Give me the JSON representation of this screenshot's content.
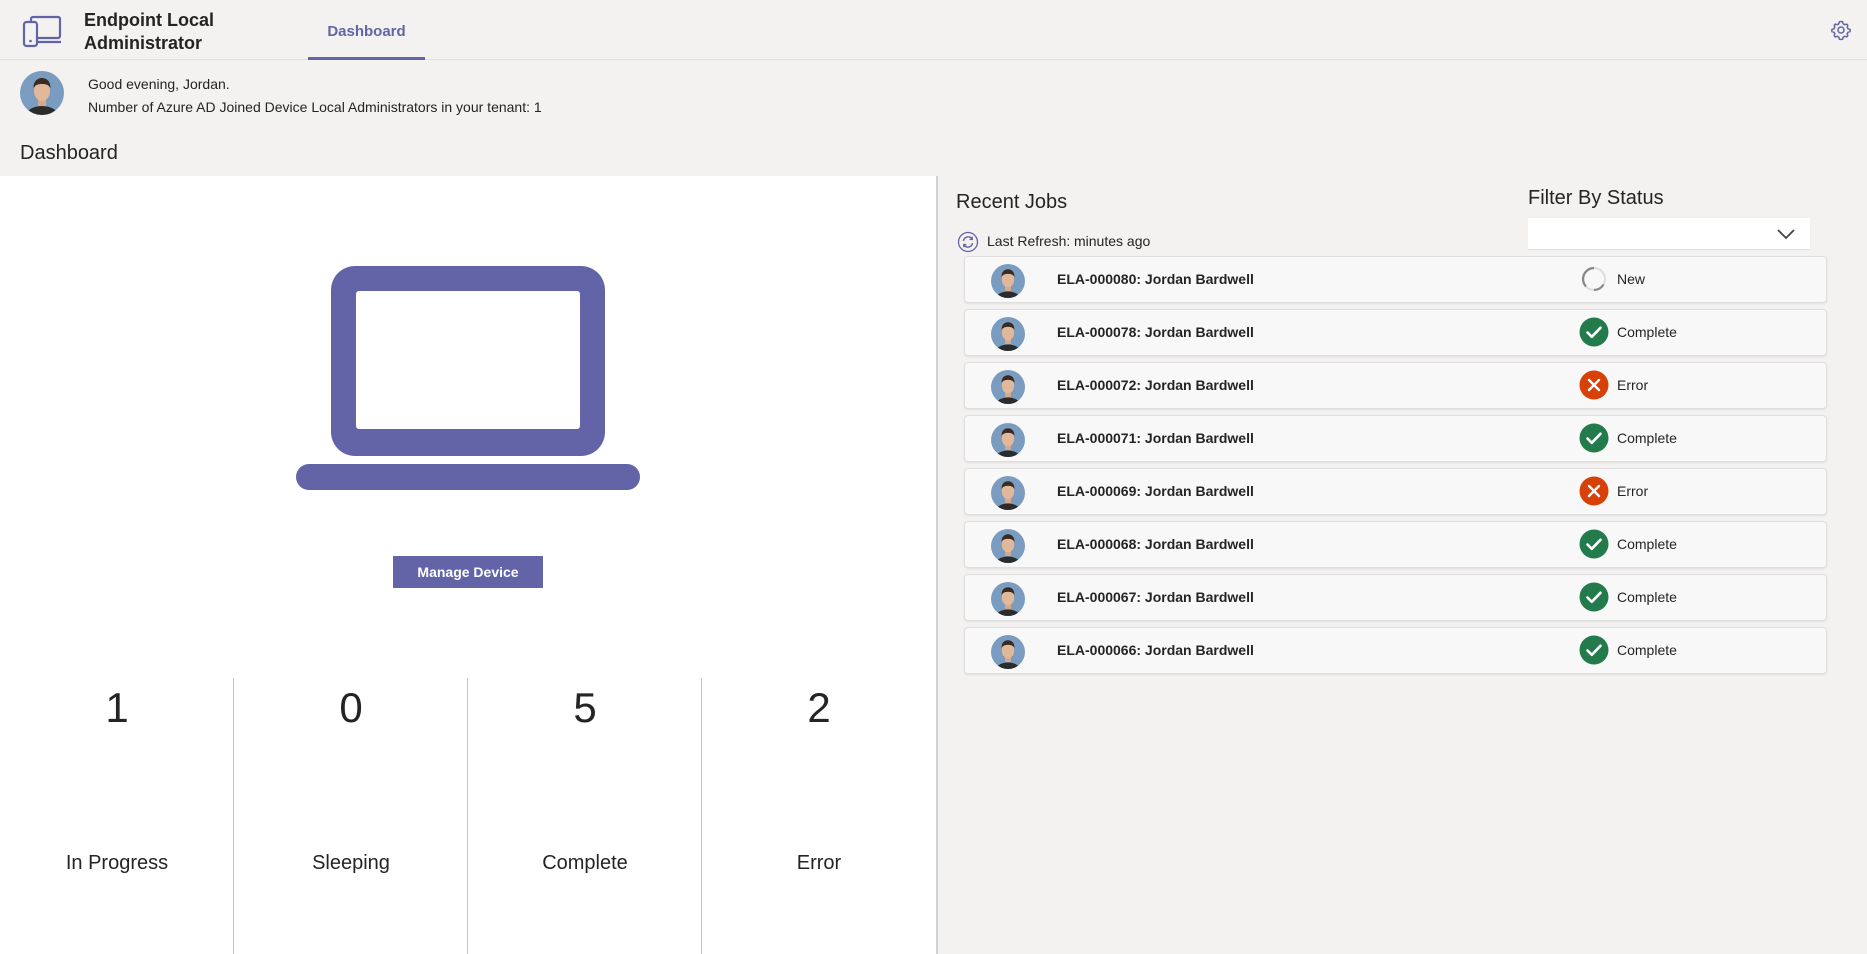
{
  "header": {
    "app_title": "Endpoint Local Administrator",
    "tab_label": "Dashboard",
    "settings_icon": "gear-icon"
  },
  "greeting": {
    "line1": "Good evening, Jordan.",
    "line2": "Number of Azure AD Joined Device Local Administrators in your tenant: 1"
  },
  "section_title": "Dashboard",
  "device": {
    "manage_button": "Manage Device"
  },
  "stats": [
    {
      "value": "1",
      "label": "In Progress"
    },
    {
      "value": "0",
      "label": "Sleeping"
    },
    {
      "value": "5",
      "label": "Complete"
    },
    {
      "value": "2",
      "label": "Error"
    }
  ],
  "jobs": {
    "title": "Recent Jobs",
    "refresh_label": "Last Refresh:",
    "refresh_time": "minutes ago",
    "filter_title": "Filter By Status",
    "filter_value": "",
    "items": [
      {
        "title": "ELA-000080: Jordan Bardwell",
        "status": "New"
      },
      {
        "title": "ELA-000078: Jordan Bardwell",
        "status": "Complete"
      },
      {
        "title": "ELA-000072: Jordan Bardwell",
        "status": "Error"
      },
      {
        "title": "ELA-000071: Jordan Bardwell",
        "status": "Complete"
      },
      {
        "title": "ELA-000069: Jordan Bardwell",
        "status": "Error"
      },
      {
        "title": "ELA-000068: Jordan Bardwell",
        "status": "Complete"
      },
      {
        "title": "ELA-000067: Jordan Bardwell",
        "status": "Complete"
      },
      {
        "title": "ELA-000066: Jordan Bardwell",
        "status": "Complete"
      }
    ]
  },
  "colors": {
    "accent": "#6264a7",
    "complete": "#237b4b",
    "error": "#c4314b",
    "error_fill": "#d74108"
  }
}
